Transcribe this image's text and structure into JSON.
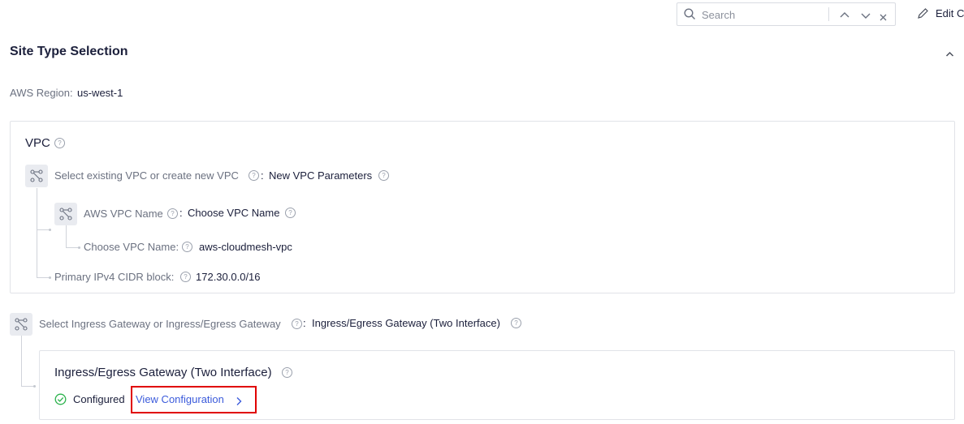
{
  "toolbar": {
    "search_placeholder": "Search",
    "search_icon": "search-icon",
    "prev_icon": "chevron-up-icon",
    "next_icon": "chevron-down-icon",
    "clear_icon": "close-icon",
    "edit_label": "Edit C",
    "edit_icon": "pencil-icon"
  },
  "section": {
    "title": "Site Type Selection",
    "collapse_icon": "chevron-up-icon"
  },
  "region": {
    "label": "AWS Region:",
    "value": "us-west-1"
  },
  "vpc": {
    "title": "VPC",
    "select": {
      "label": "Select existing VPC or create new VPC",
      "sep": ":",
      "value": "New VPC Parameters"
    },
    "name": {
      "label": "AWS VPC Name",
      "sep": ":",
      "value": "Choose VPC Name"
    },
    "choose_name": {
      "label": "Choose VPC Name:",
      "value": "aws-cloudmesh-vpc"
    },
    "cidr": {
      "label": "Primary IPv4 CIDR block:",
      "value": "172.30.0.0/16"
    }
  },
  "gateway": {
    "select": {
      "label": "Select Ingress Gateway or Ingress/Egress Gateway",
      "sep": ":",
      "value": "Ingress/Egress Gateway (Two Interface)"
    },
    "card_title": "Ingress/Egress Gateway (Two Interface)",
    "status": "Configured",
    "view_link": "View Configuration"
  },
  "colors": {
    "accent": "#3b5bdb",
    "success": "#2bb24c",
    "highlight": "#e00000"
  }
}
